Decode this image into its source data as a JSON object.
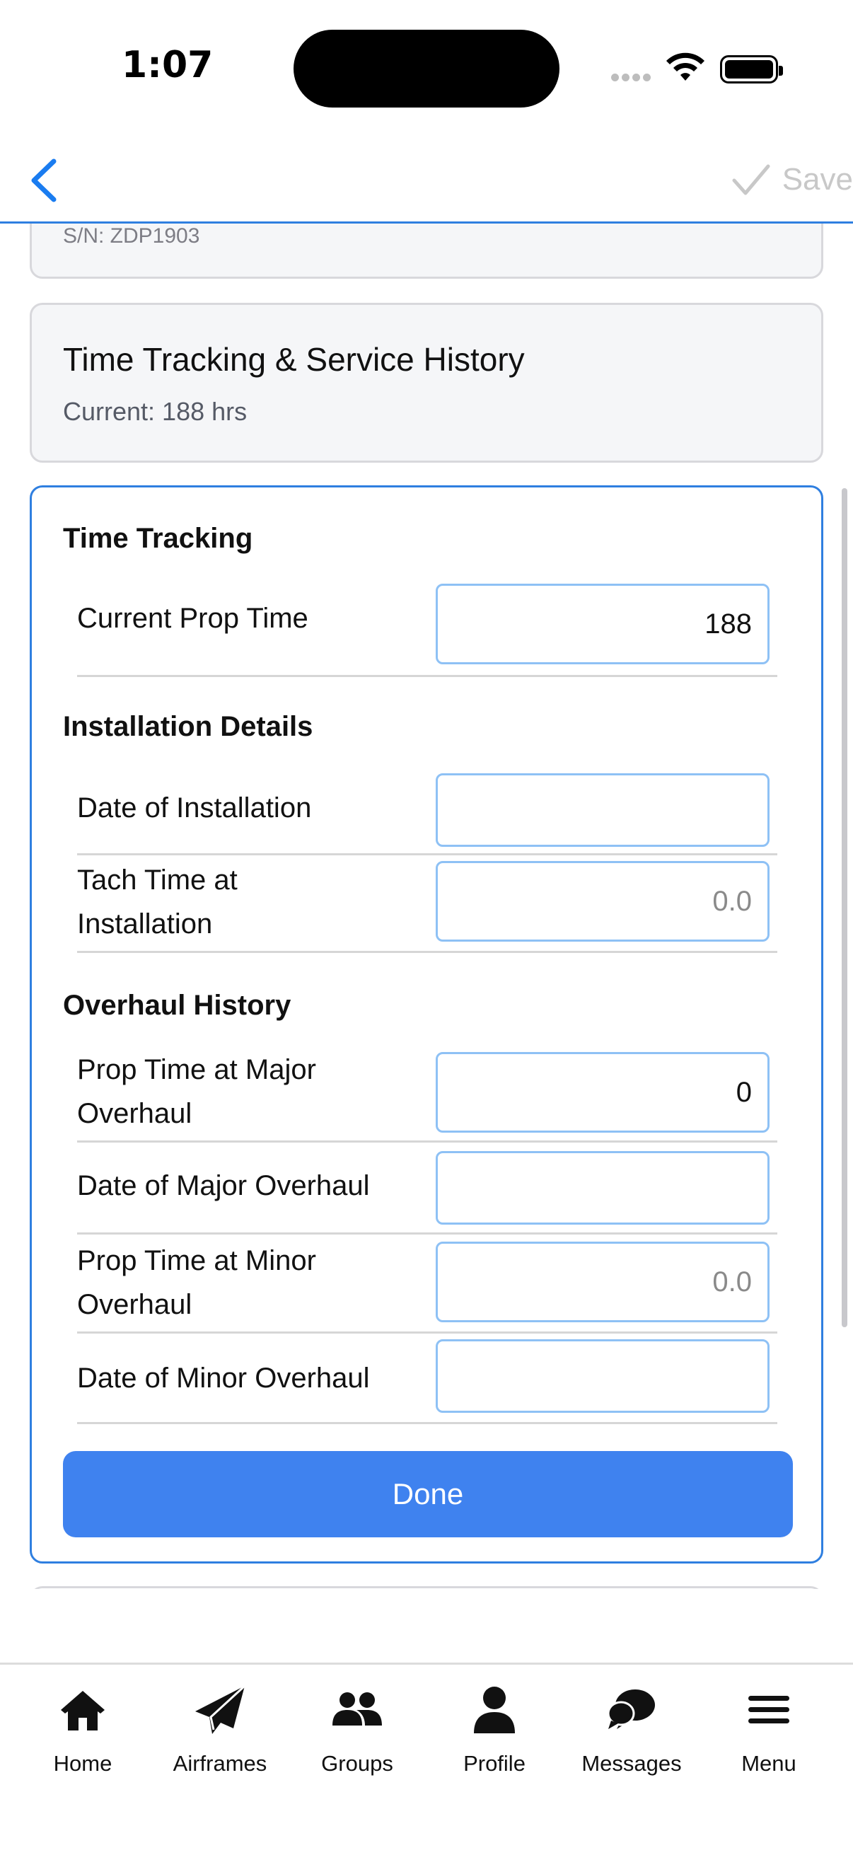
{
  "status_bar": {
    "time": "1:07"
  },
  "nav": {
    "save_label": "Save"
  },
  "serial_card": {
    "serial": "S/N: ZDP1903"
  },
  "summary_card": {
    "title": "Time Tracking & Service History",
    "subtitle": "Current: 188 hrs"
  },
  "form": {
    "time_tracking": {
      "heading": "Time Tracking",
      "current_prop_time": {
        "label": "Current Prop Time",
        "value": "188"
      }
    },
    "installation": {
      "heading": "Installation Details",
      "date_of_installation": {
        "label": "Date of Installation",
        "value": ""
      },
      "tach_time_at_installation": {
        "label": "Tach Time at Installation",
        "value": "",
        "placeholder": "0.0"
      }
    },
    "overhaul": {
      "heading": "Overhaul History",
      "prop_time_major": {
        "label": "Prop Time at Major Overhaul",
        "value": "0"
      },
      "date_major": {
        "label": "Date of Major Overhaul",
        "value": ""
      },
      "prop_time_minor": {
        "label": "Prop Time at Minor Overhaul",
        "value": "",
        "placeholder": "0.0"
      },
      "date_minor": {
        "label": "Date of Minor Overhaul",
        "value": ""
      }
    },
    "done_label": "Done"
  },
  "tabbar": {
    "items": [
      {
        "label": "Home",
        "icon": "home-icon"
      },
      {
        "label": "Airframes",
        "icon": "paper-plane-icon"
      },
      {
        "label": "Groups",
        "icon": "groups-icon"
      },
      {
        "label": "Profile",
        "icon": "profile-icon"
      },
      {
        "label": "Messages",
        "icon": "messages-icon"
      },
      {
        "label": "Menu",
        "icon": "menu-icon"
      }
    ]
  },
  "colors": {
    "accent": "#2f7fe0",
    "button": "#3f82ef",
    "field_border": "#8ec1f5",
    "save_disabled": "#c8c8c8"
  }
}
